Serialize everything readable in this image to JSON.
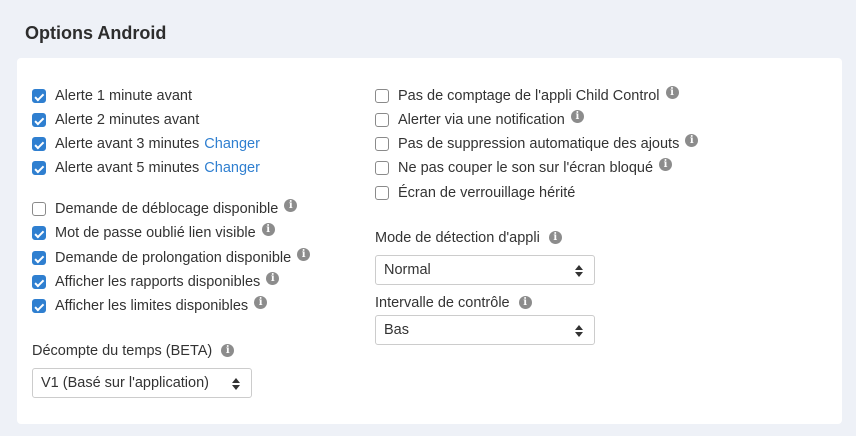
{
  "section_title": "Options Android",
  "info_glyph": "i",
  "left_group1": [
    {
      "label": "Alerte 1 minute avant",
      "checked": true
    },
    {
      "label": "Alerte 2 minutes avant",
      "checked": true
    },
    {
      "label": "Alerte avant 3 minutes",
      "checked": true,
      "link": "Changer"
    },
    {
      "label": "Alerte avant 5 minutes",
      "checked": true,
      "link": "Changer"
    }
  ],
  "left_group2": [
    {
      "label": "Demande de déblocage disponible",
      "checked": false,
      "info": true
    },
    {
      "label": "Mot de passe oublié lien visible",
      "checked": true,
      "info": true
    },
    {
      "label": "Demande de prolongation disponible",
      "checked": true,
      "info": true
    },
    {
      "label": "Afficher les rapports disponibles",
      "checked": true,
      "info": true
    },
    {
      "label": "Afficher les limites disponibles",
      "checked": true,
      "info": true
    }
  ],
  "countdown": {
    "label": "Décompte du temps (BETA)",
    "selected": "V1 (Basé sur l'application)"
  },
  "right_group": [
    {
      "label": "Pas de comptage de l'appli Child Control",
      "checked": false,
      "info": true
    },
    {
      "label": "Alerter via une notification",
      "checked": false,
      "info": true
    },
    {
      "label": "Pas de suppression automatique des ajouts",
      "checked": false,
      "info": true
    },
    {
      "label": "Ne pas couper le son sur l'écran bloqué",
      "checked": false,
      "info": true
    },
    {
      "label": "Écran de verrouillage hérité",
      "checked": false,
      "info": false
    }
  ],
  "detection_mode": {
    "label": "Mode de détection d'appli",
    "selected": "Normal"
  },
  "check_interval": {
    "label": "Intervalle de contrôle",
    "selected": "Bas"
  }
}
